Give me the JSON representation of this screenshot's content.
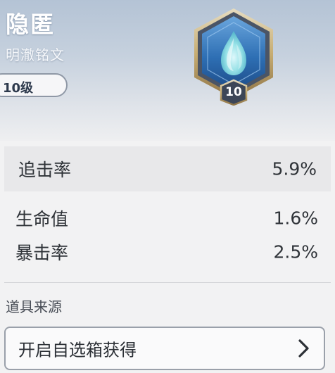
{
  "item": {
    "name": "隐匿",
    "category": "明澈铭文",
    "level_label": "10级",
    "badge_level": "10",
    "badge_icon": "water-drop-icon"
  },
  "stats": [
    {
      "name": "追击率",
      "value": "5.9%",
      "highlighted": true
    },
    {
      "name": "生命值",
      "value": "1.6%",
      "highlighted": false
    },
    {
      "name": "暴击率",
      "value": "2.5%",
      "highlighted": false
    }
  ],
  "source": {
    "label": "道具来源",
    "button_label": "开启自选箱获得",
    "button_icon": "chevron-right-icon"
  },
  "colors": {
    "badge_blue": "#2f6fb5",
    "badge_frame": "#4e5a6b",
    "badge_gold": "#c9a962",
    "drop_cyan": "#a9f0f0"
  }
}
